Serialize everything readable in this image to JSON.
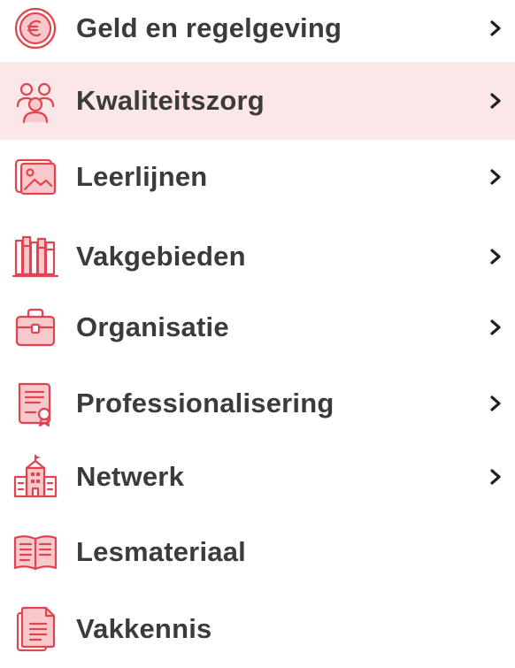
{
  "menu": {
    "items": [
      {
        "label": "Geld en regelgeving",
        "icon": "euro-coin-icon",
        "has_submenu": true,
        "active": false
      },
      {
        "label": "Kwaliteitszorg",
        "icon": "people-group-icon",
        "has_submenu": true,
        "active": true
      },
      {
        "label": "Leerlijnen",
        "icon": "picture-frame-icon",
        "has_submenu": true,
        "active": false
      },
      {
        "label": "Vakgebieden",
        "icon": "bookshelf-icon",
        "has_submenu": true,
        "active": false
      },
      {
        "label": "Organisatie",
        "icon": "briefcase-icon",
        "has_submenu": true,
        "active": false
      },
      {
        "label": "Professionalisering",
        "icon": "certificate-icon",
        "has_submenu": true,
        "active": false
      },
      {
        "label": "Netwerk",
        "icon": "school-building-icon",
        "has_submenu": true,
        "active": false
      },
      {
        "label": "Lesmateriaal",
        "icon": "open-book-icon",
        "has_submenu": false,
        "active": false
      },
      {
        "label": "Vakkennis",
        "icon": "document-icon",
        "has_submenu": false,
        "active": false
      }
    ]
  },
  "colors": {
    "icon_accent": "#e0454f",
    "active_background": "#fbe7e8",
    "label_text": "#3b3b3b",
    "chevron": "#222222"
  }
}
